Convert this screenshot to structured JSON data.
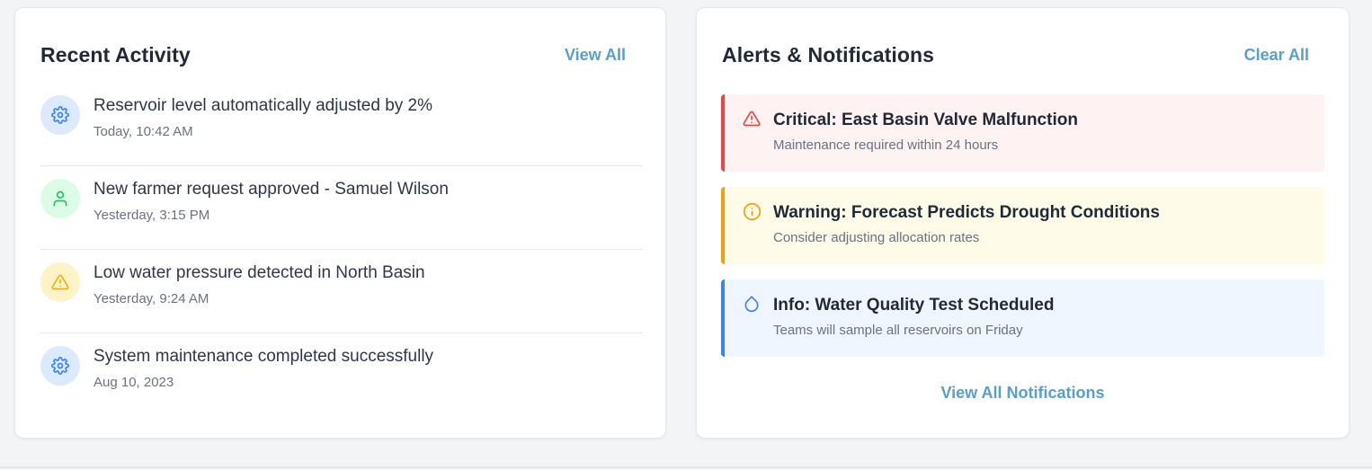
{
  "activity": {
    "title": "Recent Activity",
    "view_all": "View All",
    "items": [
      {
        "title": "Reservoir level automatically adjusted by 2%",
        "time": "Today, 10:42 AM",
        "icon": "gear-icon",
        "color": "#3b82f6"
      },
      {
        "title": "New farmer request approved - Samuel Wilson",
        "time": "Yesterday, 3:15 PM",
        "icon": "user-icon",
        "color": "#22c55e"
      },
      {
        "title": "Low water pressure detected in North Basin",
        "time": "Yesterday, 9:24 AM",
        "icon": "warning-triangle-icon",
        "color": "#eab308"
      },
      {
        "title": "System maintenance completed successfully",
        "time": "Aug 10, 2023",
        "icon": "gear-icon",
        "color": "#3b82f6"
      }
    ]
  },
  "alerts": {
    "title": "Alerts & Notifications",
    "clear_all": "Clear All",
    "items": [
      {
        "title": "Critical: East Basin Valve Malfunction",
        "desc": "Maintenance required within 24 hours",
        "level": "critical",
        "icon": "alert-triangle-icon",
        "color": "#ef4444"
      },
      {
        "title": "Warning: Forecast Predicts Drought Conditions",
        "desc": "Consider adjusting allocation rates",
        "level": "warning",
        "icon": "info-circle-icon",
        "color": "#f59e0b"
      },
      {
        "title": "Info: Water Quality Test Scheduled",
        "desc": "Teams will sample all reservoirs on Friday",
        "level": "info",
        "icon": "water-drop-icon",
        "color": "#3b82f6"
      }
    ],
    "view_all_notifications": "View All Notifications"
  }
}
